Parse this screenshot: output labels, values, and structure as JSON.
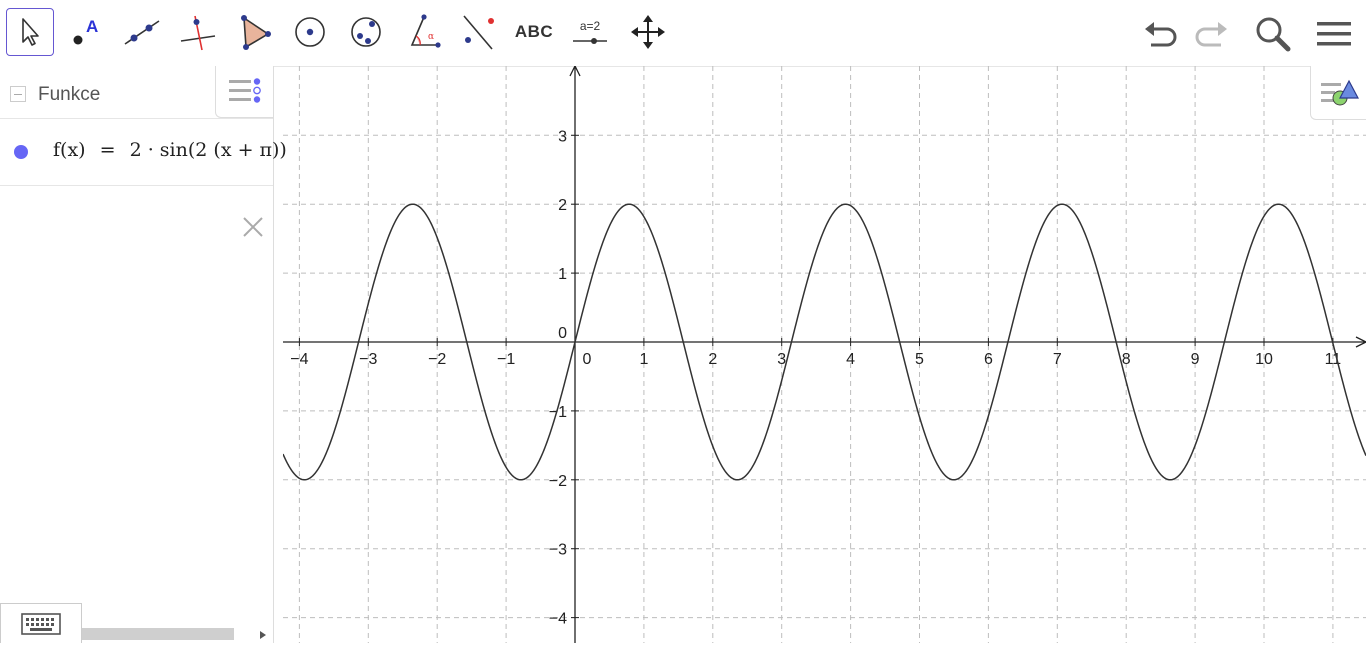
{
  "toolbar": {
    "tools": [
      "move-tool",
      "point-tool",
      "line-tool",
      "perpendicular-tool",
      "polygon-tool",
      "circle-center-tool",
      "conic-tool",
      "angle-tool",
      "reflect-tool",
      "text-tool",
      "slider-tool",
      "move-graphics-tool"
    ],
    "text_tool_label": "ABC",
    "slider_tool_label": "a=2",
    "right": [
      "undo",
      "redo",
      "search",
      "menu"
    ]
  },
  "algebra": {
    "header": "Funkce",
    "item": {
      "color": "#6666f5",
      "name": "f(x)",
      "equals": "=",
      "expression": "2 · sin(2 (x + π))"
    }
  },
  "graph": {
    "x_ticks": [
      "−4",
      "−3",
      "−2",
      "−1",
      "0",
      "1",
      "2",
      "3",
      "4",
      "5",
      "6",
      "7",
      "8",
      "9",
      "10",
      "11"
    ],
    "x_values": [
      -4,
      -3,
      -2,
      -1,
      0,
      1,
      2,
      3,
      4,
      5,
      6,
      7,
      8,
      9,
      10,
      11
    ],
    "y_ticks": [
      "3",
      "2",
      "1",
      "0",
      "−1",
      "−2",
      "−3",
      "−4"
    ],
    "y_values": [
      3,
      2,
      1,
      0,
      -1,
      -2,
      -3,
      -4
    ],
    "x_range": [
      -4.2,
      11.5
    ],
    "y_range": [
      -4.3,
      3.9
    ],
    "function": {
      "amplitude": 2,
      "frequency": 2,
      "phase": 3.14159,
      "color": "#333333"
    },
    "grid": true,
    "axis_color": "#222222",
    "grid_color": "#bdbdbd"
  }
}
